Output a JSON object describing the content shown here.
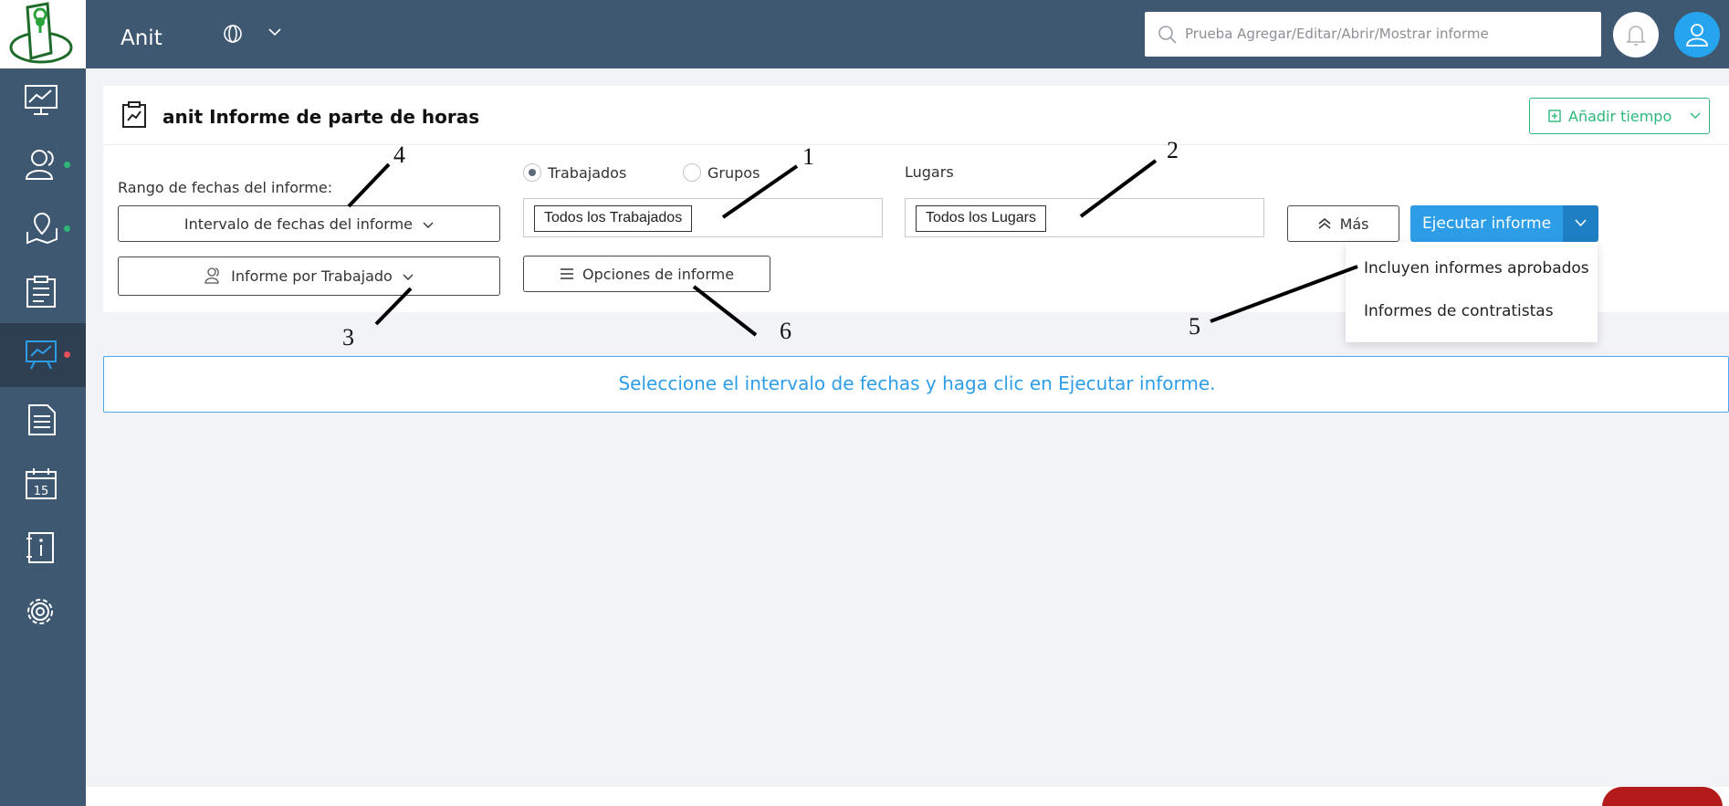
{
  "app": {
    "title": "Anit"
  },
  "topbar": {
    "search_placeholder": "Prueba Agregar/Editar/Abrir/Mostrar informe",
    "icons": [
      "globe-icon",
      "chevron-down-icon",
      "search-icon",
      "bell-icon",
      "user-icon"
    ]
  },
  "sidebar": {
    "items": [
      {
        "name": "dashboard",
        "icon": "monitor-chart-icon",
        "dot": ""
      },
      {
        "name": "workers",
        "icon": "users-icon",
        "dot": "#2db87a"
      },
      {
        "name": "locations",
        "icon": "map-pin-icon",
        "dot": "#2db87a"
      },
      {
        "name": "timesheets",
        "icon": "clipboard-icon",
        "dot": ""
      },
      {
        "name": "reports",
        "icon": "presentation-chart-icon",
        "dot": "#e8505b",
        "active": true
      },
      {
        "name": "documents",
        "icon": "document-icon",
        "dot": ""
      },
      {
        "name": "calendar",
        "icon": "calendar-icon",
        "dot": "",
        "calendar_day": "15"
      },
      {
        "name": "info",
        "icon": "info-book-icon",
        "dot": ""
      },
      {
        "name": "settings",
        "icon": "gear-icon",
        "dot": ""
      }
    ]
  },
  "page": {
    "title": "anit Informe de parte de horas",
    "add_time_label": "Añadir tiempo"
  },
  "filters": {
    "date_range_label": "Rango de fechas del informe:",
    "date_range_button": "Intervalo de fechas del informe",
    "group_by_button": "Informe por Trabajado",
    "radio_workers": "Trabajados",
    "radio_groups": "Grupos",
    "workers_tag": "Todos los Trabajados",
    "places_label": "Lugars",
    "places_tag": "Todos los Lugars",
    "options_button": "Opciones de informe",
    "more_button": "Más",
    "run_button": "Ejecutar informe"
  },
  "run_menu": {
    "items": [
      "Incluyen informes aprobados",
      "Informes de contratistas"
    ]
  },
  "info_message": "Seleccione el intervalo de fechas y haga clic en Ejecutar informe.",
  "annotations": [
    "1",
    "2",
    "3",
    "4",
    "5",
    "6"
  ],
  "colors": {
    "sidebar_bg": "#3f5872",
    "accent_blue": "#2d9de8",
    "accent_green": "#2db87a",
    "alert_red": "#e8505b"
  }
}
